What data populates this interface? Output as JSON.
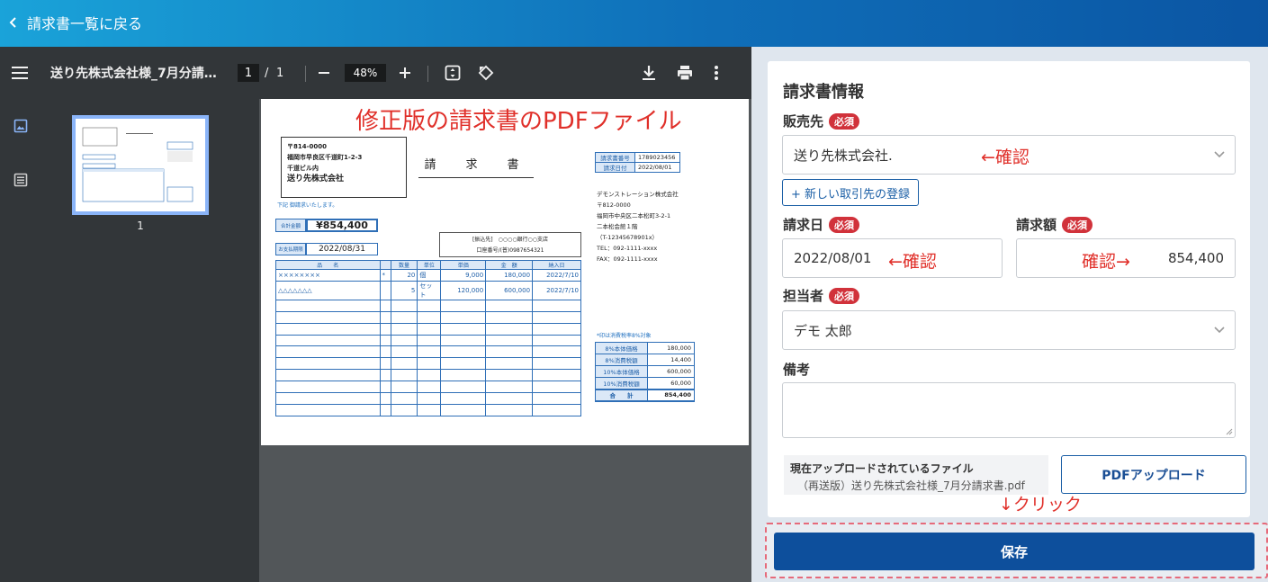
{
  "header": {
    "back_label": "請求書一覧に戻る"
  },
  "viewer": {
    "doc_title": "送り先株式会社様_7月分請…",
    "page_current": "1",
    "page_sep": "/",
    "page_total": "1",
    "zoom": "48%",
    "thumb_label": "1"
  },
  "document": {
    "overlay_title": "修正版の請求書のPDFファイル",
    "address": [
      "〒814-0000",
      "福岡市早良区千道町1-2-3",
      "千道ビル内"
    ],
    "recipient": "送り先株式会社",
    "note": "下記 御請求いたします。",
    "heading": "請　求　書",
    "total_label": "合計金額",
    "total_value": "¥854,400",
    "due_label": "お支払期限",
    "due_value": "2022/08/31",
    "bank_line1": "[振込先]　○○○○銀行○○支店",
    "bank_line2": "口座番号/(普)0987654321",
    "meta": [
      {
        "k": "請求書番号",
        "v": "1789023456"
      },
      {
        "k": "請求日付",
        "v": "2022/08/01"
      }
    ],
    "company": [
      "デモンストレーション株式会社",
      "〒812-0000",
      "福岡市中央区二本松町3-2-1",
      "二本松会館１階",
      "（T-12345678901x）",
      "TEL：092-1111-xxxx",
      "FAX：092-1111-xxxx"
    ],
    "items_headers": [
      "品　　名",
      "",
      "数量",
      "単位",
      "単価",
      "金　額",
      "納入日"
    ],
    "items": [
      [
        "××××××××",
        "*",
        "20",
        "個",
        "9,000",
        "180,000",
        "2022/7/10"
      ],
      [
        "△△△△△△△",
        "",
        "5",
        "セット",
        "120,000",
        "600,000",
        "2022/7/10"
      ]
    ],
    "tax_note": "*印は消費税率8%対象",
    "tax": [
      {
        "k": "8%本体価格",
        "v": "180,000"
      },
      {
        "k": "8%消費税額",
        "v": "14,400"
      },
      {
        "k": "10%本体価格",
        "v": "600,000"
      },
      {
        "k": "10%消費税額",
        "v": "60,000"
      }
    ],
    "tax_total_label": "合　　計",
    "tax_total_value": "854,400"
  },
  "form": {
    "title": "請求書情報",
    "required_badge": "必須",
    "customer_label": "販売先",
    "customer_value": "送り先株式会社.",
    "customer_annot": "←確認",
    "new_client_btn": "+ 新しい取引先の登録",
    "date_label": "請求日",
    "date_value": "2022/08/01",
    "date_annot": "←確認",
    "amount_label": "請求額",
    "amount_value": "854,400",
    "amount_annot": "確認→",
    "person_label": "担当者",
    "person_value": "デモ 太郎",
    "notes_label": "備考",
    "notes_value": "",
    "uploaded_title": "現在アップロードされているファイル",
    "uploaded_name": "（再送版）送り先株式会社様_7月分請求書.pdf",
    "upload_btn": "PDFアップロード",
    "click_annot": "↓クリック",
    "save_btn": "保存"
  },
  "colors": {
    "accent": "#0d4f9c",
    "required": "#d1323b",
    "annotation": "#e0302a"
  },
  "icons": [
    "chevron-left-icon",
    "hamburger-menu-icon",
    "minus-icon",
    "plus-icon",
    "fit-page-icon",
    "rotate-icon",
    "download-icon",
    "print-icon",
    "more-vert-icon",
    "image-icon",
    "list-icon",
    "chevron-down-icon"
  ]
}
